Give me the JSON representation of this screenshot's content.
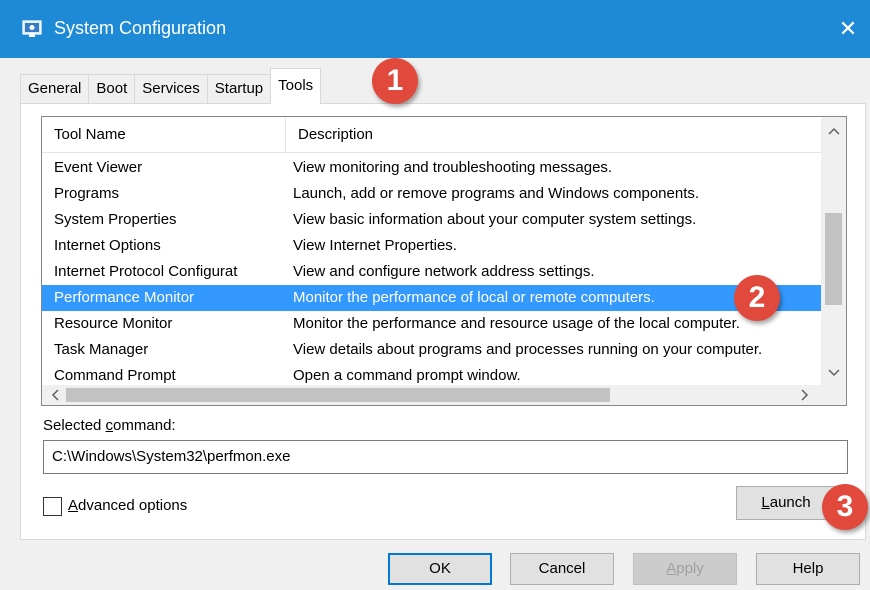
{
  "window": {
    "title": "System Configuration",
    "close_glyph": "✕",
    "accent_color": "#1e8ad6"
  },
  "tabs": [
    {
      "label": "General",
      "active": false
    },
    {
      "label": "Boot",
      "active": false
    },
    {
      "label": "Services",
      "active": false
    },
    {
      "label": "Startup",
      "active": false
    },
    {
      "label": "Tools",
      "active": true
    }
  ],
  "tool_list": {
    "columns": [
      "Tool Name",
      "Description"
    ],
    "rows": [
      {
        "name": "Event Viewer",
        "description": "View monitoring and troubleshooting messages."
      },
      {
        "name": "Programs",
        "description": "Launch, add or remove programs and Windows components."
      },
      {
        "name": "System Properties",
        "description": "View basic information about your computer system settings."
      },
      {
        "name": "Internet Options",
        "description": "View Internet Properties."
      },
      {
        "name": "Internet Protocol Configurat",
        "description": "View and configure network address settings."
      },
      {
        "name": "Performance Monitor",
        "description": "Monitor the performance of local or remote computers."
      },
      {
        "name": "Resource Monitor",
        "description": "Monitor the performance and resource usage of the local computer."
      },
      {
        "name": "Task Manager",
        "description": "View details about programs and processes running on your computer."
      },
      {
        "name": "Command Prompt",
        "description": "Open a command prompt window."
      }
    ],
    "selected_index": 5,
    "selection_color": "#3399ff"
  },
  "selected_command": {
    "label_prefix": "Selected ",
    "label_underlined": "c",
    "label_suffix": "ommand:",
    "value": "C:\\Windows\\System32\\perfmon.exe"
  },
  "advanced_options": {
    "label_underlined": "A",
    "label_rest": "dvanced options",
    "checked": false
  },
  "buttons": {
    "launch_underlined": "L",
    "launch_rest": "aunch",
    "ok": "OK",
    "cancel": "Cancel",
    "apply_underlined": "A",
    "apply_rest": "pply",
    "help": "Help"
  },
  "markers": [
    "1",
    "2",
    "3"
  ],
  "marker_color": "#e0493c"
}
